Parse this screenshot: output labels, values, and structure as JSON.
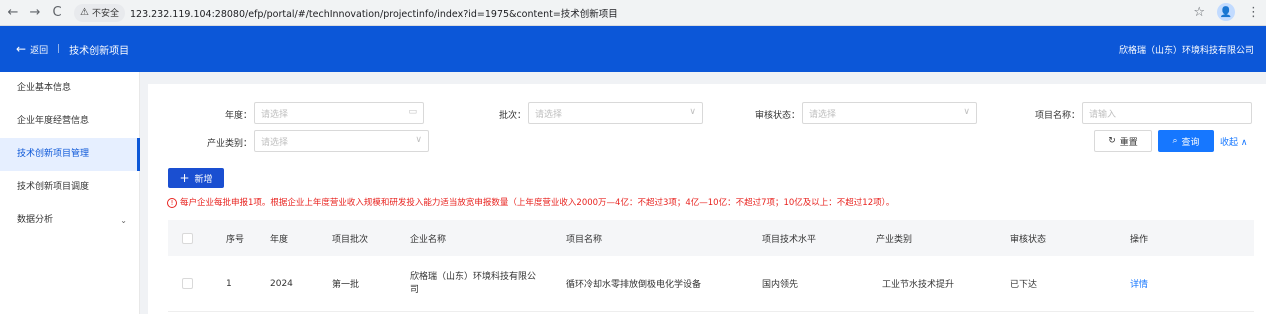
{
  "browser": {
    "back_icon": "←",
    "forward_icon": "→",
    "reload_icon": "C",
    "security_warning_icon": "⚠",
    "security_label": "不安全",
    "url": "123.232.119.104:28080/efp/portal/#/techInnovation/projectinfo/index?id=1975&content=技术创新项目",
    "bookmark_icon": "☆",
    "profile_icon": "👤",
    "menu_icon": "⋮"
  },
  "header": {
    "back_icon": "←",
    "back_label": "返回",
    "separator": "|",
    "title": "技术创新项目",
    "company": "欣格瑞（山东）环境科技有限公司",
    "background": "#0c57d8"
  },
  "sidebar": {
    "items": [
      {
        "label": "企业基本信息",
        "active": false
      },
      {
        "label": "企业年度经营信息",
        "active": false
      },
      {
        "label": "技术创新项目管理",
        "active": true
      },
      {
        "label": "技术创新项目调度",
        "active": false
      },
      {
        "label": "数据分析",
        "active": false,
        "has_submenu": true
      }
    ],
    "chevron_icon": "⌄"
  },
  "filters": {
    "year": {
      "label": "年度：",
      "placeholder": "请选择",
      "icon": "▭"
    },
    "batch": {
      "label": "批次：",
      "placeholder": "请选择",
      "icon": "∨"
    },
    "review_status": {
      "label": "审核状态：",
      "placeholder": "请选择",
      "icon": "∨"
    },
    "project_name": {
      "label": "项目名称：",
      "placeholder": "请输入"
    },
    "industry": {
      "label": "产业类别：",
      "placeholder": "请选择",
      "icon": "∨"
    }
  },
  "actions": {
    "reset_icon": "↻",
    "reset_label": "重置",
    "query_icon": "⌕",
    "query_label": "查询",
    "collapse_label": "收起 ∧",
    "add_icon": "+",
    "add_label": "新增"
  },
  "notice": {
    "icon": "!",
    "text": "每户企业每批申报1项。根据企业上年度营业收入规模和研发投入能力适当放宽申报数量（上年度营业收入2000万—4亿：不超过3项；4亿—10亿：不超过7项；10亿及以上：不超过12项）。"
  },
  "table": {
    "columns": [
      "序号",
      "年度",
      "项目批次",
      "企业名称",
      "项目名称",
      "项目技术水平",
      "产业类别",
      "审核状态",
      "操作"
    ],
    "rows": [
      {
        "index": "1",
        "year": "2024",
        "batch": "第一批",
        "company": "欣格瑞（山东）环境科技有限公司",
        "project": "循环冷却水零排放倒极电化学设备",
        "tech_level": "国内领先",
        "industry": "工业节水技术提升",
        "status": "已下达",
        "action": "详情"
      }
    ]
  },
  "colors": {
    "primary": "#1677ff",
    "header_blue": "#0c57d8",
    "notice_red": "#e8231f"
  }
}
